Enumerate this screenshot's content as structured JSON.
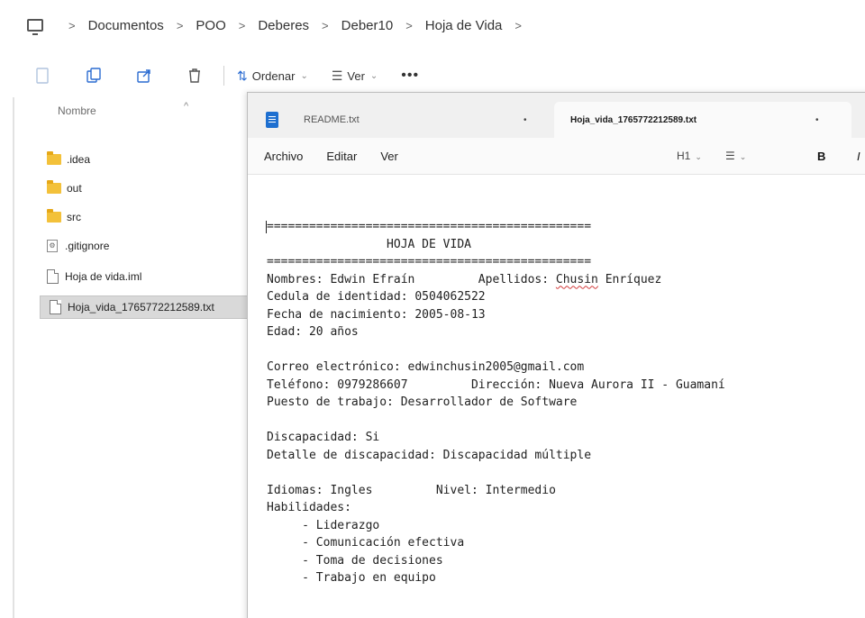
{
  "address": {
    "breadcrumbs": [
      "Documentos",
      "POO",
      "Deberes",
      "Deber10",
      "Hoja de Vida"
    ],
    "separator": ">"
  },
  "toolbar": {
    "icons": [
      "new-folder-icon",
      "copy-icon",
      "share-icon",
      "delete-icon"
    ],
    "sort_label": "Ordenar",
    "view_label": "Ver",
    "more_label": "•••"
  },
  "explorer": {
    "column_header": "Nombre",
    "files": [
      {
        "name": ".idea",
        "type": "folder"
      },
      {
        "name": "out",
        "type": "folder"
      },
      {
        "name": "src",
        "type": "folder"
      },
      {
        "name": ".gitignore",
        "type": "config-file"
      },
      {
        "name": "Hoja de vida.iml",
        "type": "file"
      },
      {
        "name": "Hoja_vida_1765772212589.txt",
        "type": "file",
        "selected": true
      }
    ]
  },
  "notepad": {
    "tabs": [
      {
        "label": "README.txt",
        "modified_marker": "•"
      },
      {
        "label": "Hoja_vida_1765772212589.txt",
        "modified_marker": "•"
      }
    ],
    "new_tab_label": "+",
    "menu": [
      "Archivo",
      "Editar",
      "Ver"
    ],
    "format": {
      "heading": "H1",
      "list": "☰",
      "bold": "B",
      "italic": "I"
    },
    "content": {
      "sep1": "==============================================",
      "heading": "                 HOJA DE VIDA",
      "sep2": "==============================================",
      "nombres_prefix": "Nombres: Edwin Efraín         Apellidos: ",
      "apellido1": "Chusin",
      "nombres_suffix": " Enríquez",
      "cedula": "Cedula de identidad: 0504062522",
      "fecha": "Fecha de nacimiento: 2005-08-13",
      "edad": "Edad: 20 años",
      "correo": "Correo electrónico: edwinchusin2005@gmail.com",
      "telefono": "Teléfono: 0979286607         Dirección: Nueva Aurora II - Guamaní",
      "puesto": "Puesto de trabajo: Desarrollador de Software",
      "discapacidad": "Discapacidad: Si",
      "detalle": "Detalle de discapacidad: Discapacidad múltiple",
      "idiomas": "Idiomas: Ingles         Nivel: Intermedio",
      "habilidades": "Habilidades:",
      "skills": [
        "     - Liderazgo",
        "     - Comunicación efectiva",
        "     - Toma de decisiones",
        "     - Trabajo en equipo"
      ]
    }
  }
}
